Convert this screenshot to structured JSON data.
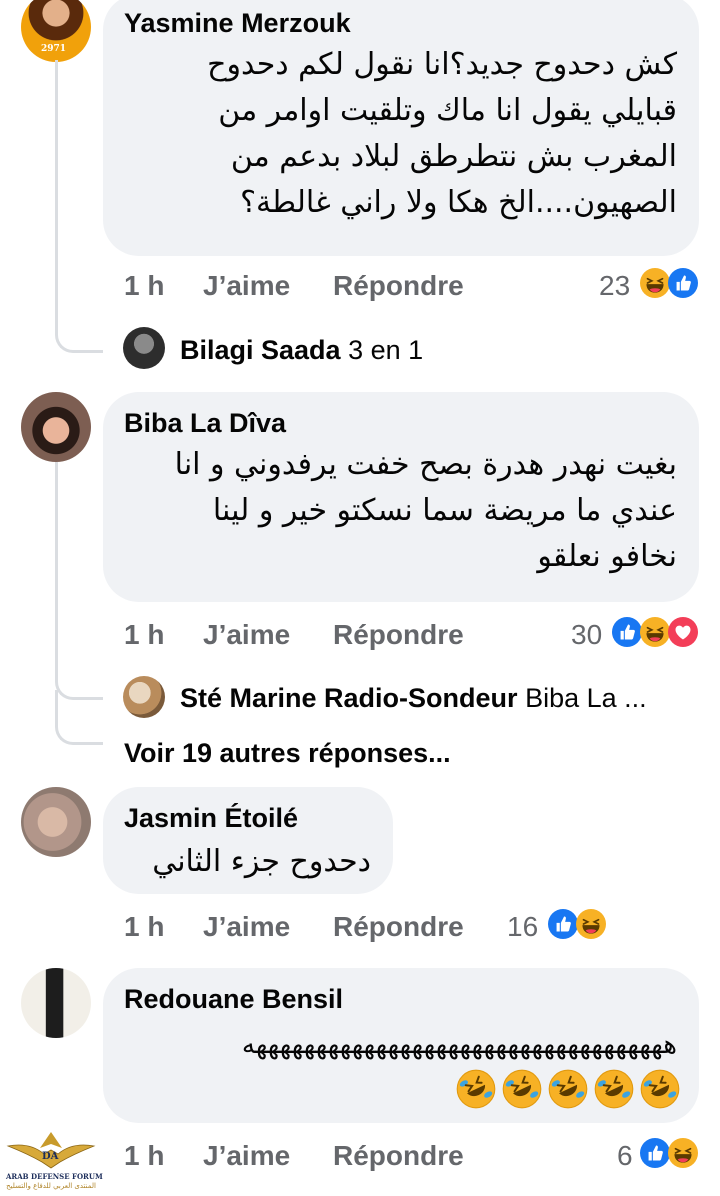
{
  "comments": [
    {
      "author": "Yasmine Merzouk",
      "lines": [
        "كش دحدوح جديد؟انا نقول لكم دحدوح",
        "قبايلي يقول انا ماك وتلقيت اوامر من",
        "المغرب بش نتطرطق لبلاد بدعم من",
        "الصهيون....الخ هكا ولا راني غالطة؟"
      ],
      "time": "1 h",
      "like_label": "J’aime",
      "reply_label": "Répondre",
      "reaction_count": "23",
      "reactions": [
        "haha-icon",
        "like-icon"
      ],
      "avatar_badge": "2971"
    },
    {
      "author": "Biba La Dîva",
      "lines": [
        "بغيت نهدر هدرة بصح خفت يرفدوني و انا",
        "عندي ما مريضة سما نسكتو خير و لينا",
        "نخافو نعلقو"
      ],
      "time": "1 h",
      "like_label": "J’aime",
      "reply_label": "Répondre",
      "reaction_count": "30",
      "reactions": [
        "like-icon",
        "haha-icon",
        "love-icon"
      ]
    },
    {
      "author": "Jasmin Étoilé",
      "lines": [
        "دحدوح جزء الثاني"
      ],
      "time": "1 h",
      "like_label": "J’aime",
      "reply_label": "Répondre",
      "reaction_count": "16",
      "reactions": [
        "like-icon",
        "haha-icon"
      ]
    },
    {
      "author": "Redouane Bensil",
      "lines": [
        "هههههههههههههههههههههههههههههههههههه"
      ],
      "time": "1 h",
      "like_label": "J’aime",
      "reply_label": "Répondre",
      "reaction_count": "6",
      "reactions": [
        "like-icon",
        "haha-icon"
      ],
      "emoji_row_count": 5
    }
  ],
  "replies": [
    {
      "author": "Bilagi Saada",
      "text": "3 en 1"
    },
    {
      "author": "Sté Marine Radio-Sondeur",
      "text": "Biba La ..."
    }
  ],
  "more_replies": "Voir 19 autres réponses...",
  "watermark": {
    "logo_text": "DA",
    "line1": "ARAB DEFENSE FORUM",
    "line2": "المنتدى العربي للدفاع والتسليح"
  },
  "colors": {
    "bubble": "#f0f2f5",
    "like": "#1877f2",
    "haha": "#f7b125",
    "love": "#f33e58",
    "meta": "#65676b"
  }
}
